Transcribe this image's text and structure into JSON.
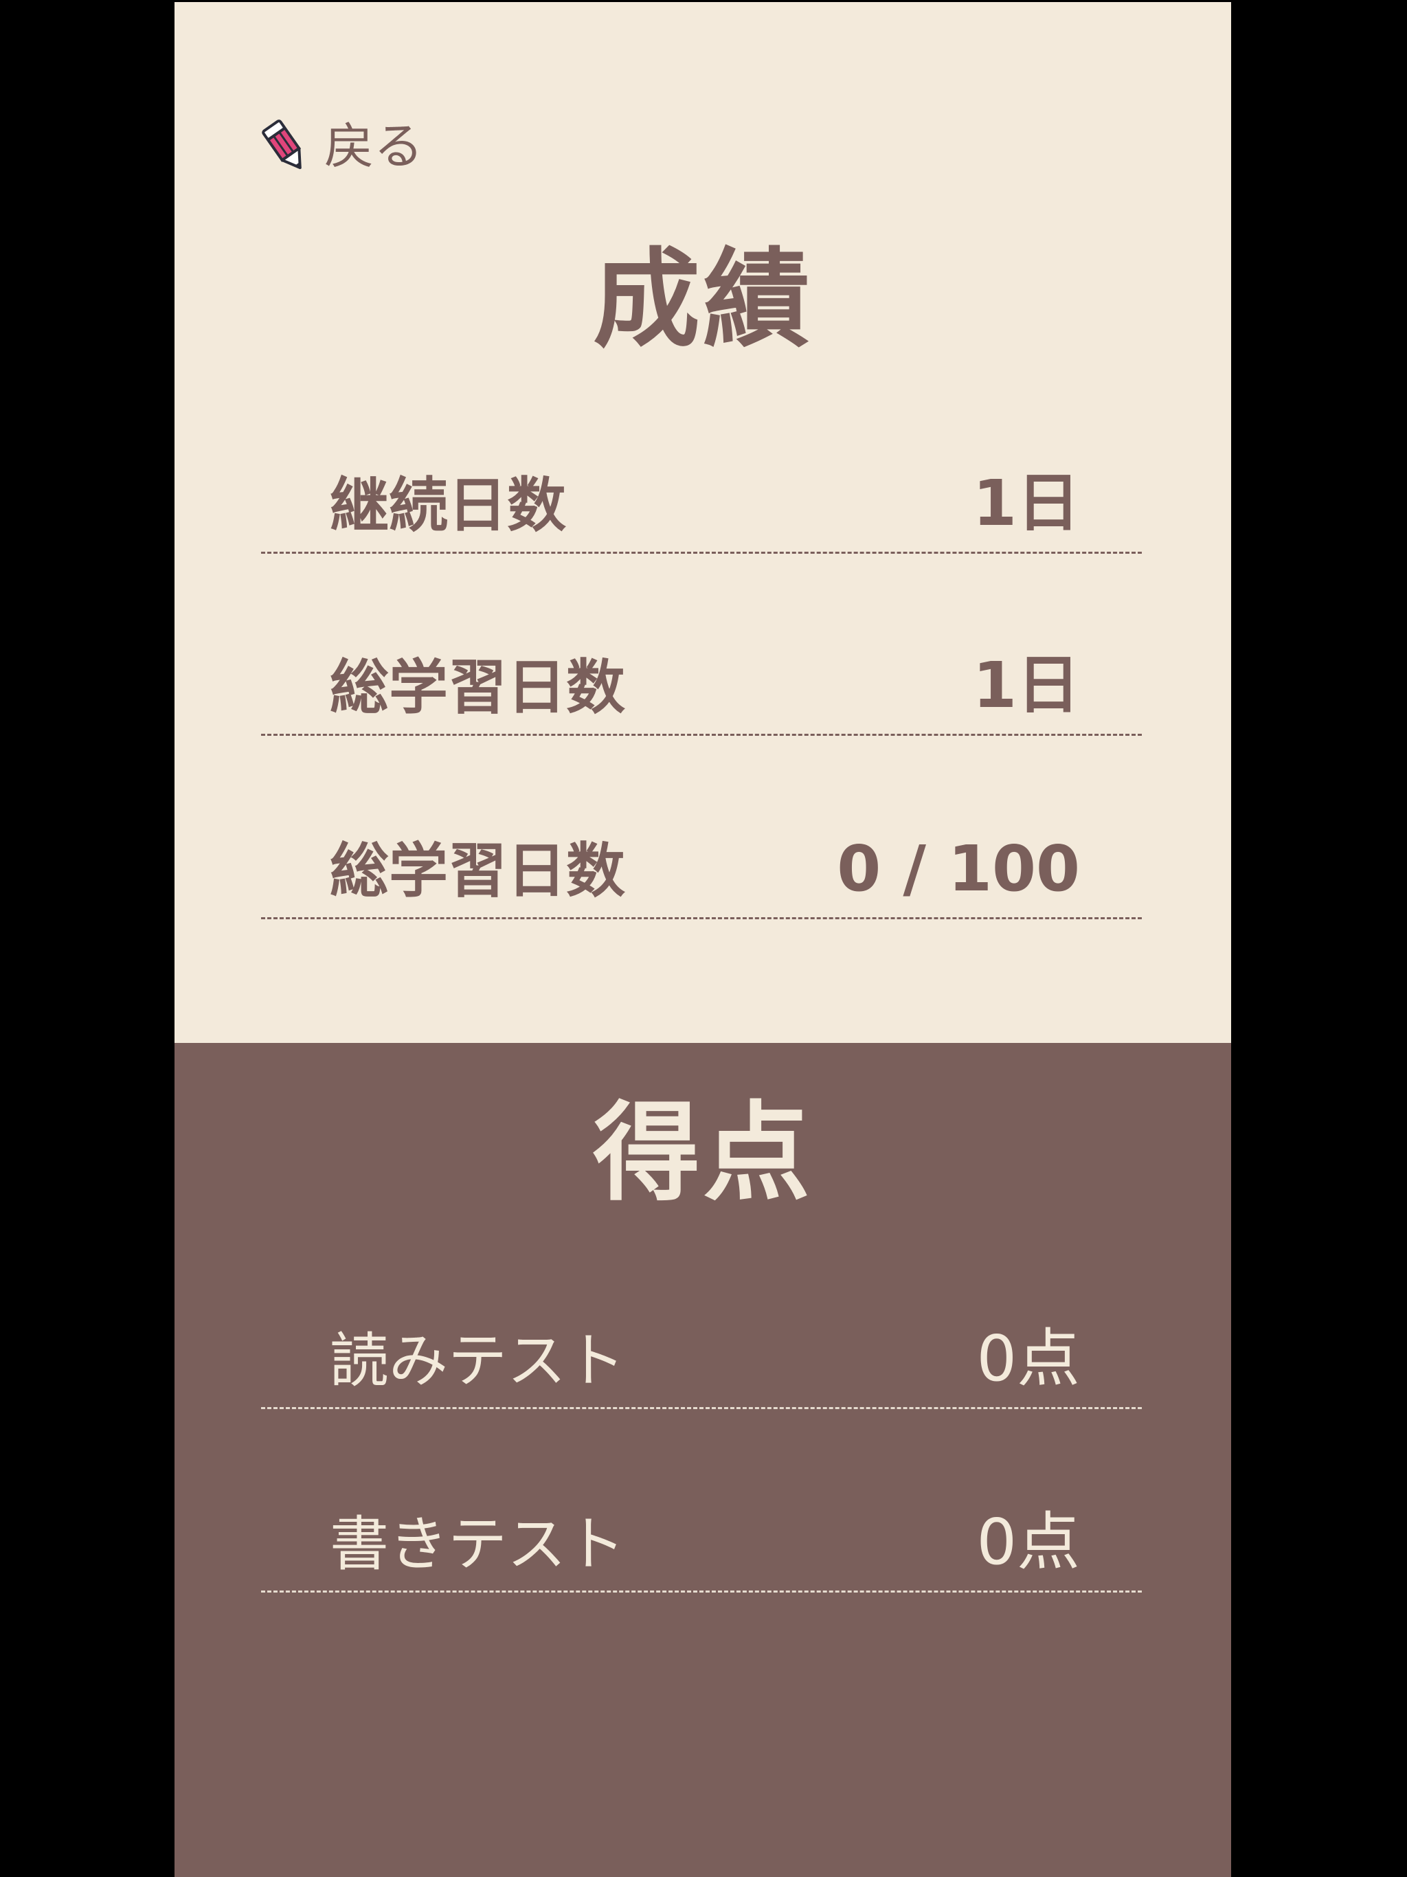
{
  "header": {
    "back_label": "戻る",
    "back_icon": "pencil-icon"
  },
  "record": {
    "title": "成績",
    "rows": [
      {
        "label": "継続日数",
        "value": "1日"
      },
      {
        "label": "総学習日数",
        "value": "1日"
      },
      {
        "label": "総学習日数",
        "value": "0 / 100"
      }
    ]
  },
  "scores": {
    "title": "得点",
    "rows": [
      {
        "label": "読みテスト",
        "value": "0点"
      },
      {
        "label": "書きテスト",
        "value": "0点"
      }
    ]
  },
  "colors": {
    "upper_bg": "#f3eadb",
    "lower_bg": "#7a5f5b",
    "text_brown": "#7a5f5b",
    "text_cream": "#f3eadb",
    "pencil_pink": "#e0457b"
  }
}
